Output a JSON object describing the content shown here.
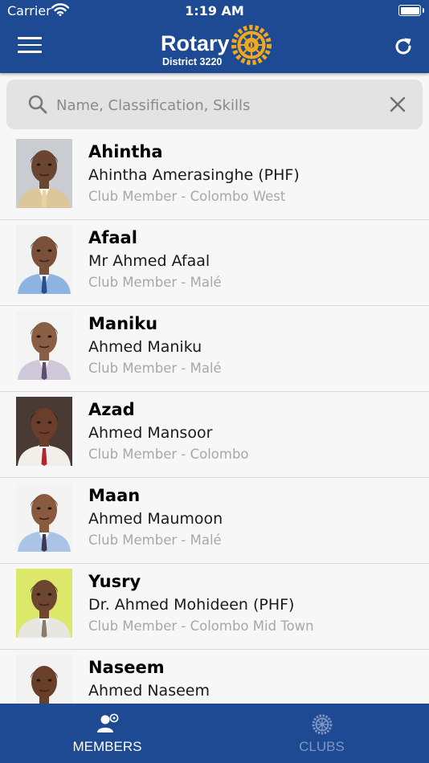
{
  "status_bar": {
    "carrier": "Carrier",
    "time": "1:19 AM"
  },
  "header": {
    "logo_word": "Rotary",
    "logo_subtitle": "District 3220",
    "menu_icon": "hamburger-menu-icon",
    "refresh_icon": "refresh-icon"
  },
  "search": {
    "placeholder": "Name, Classification, Skills",
    "value": "",
    "clear_icon": "close-icon"
  },
  "members": [
    {
      "nickname": "Ahintha",
      "full_name": "Ahintha Amerasinghe (PHF)",
      "club": "Club Member - Colombo West"
    },
    {
      "nickname": "Afaal",
      "full_name": "Mr Ahmed Afaal",
      "club": "Club Member - Malé"
    },
    {
      "nickname": "Maniku",
      "full_name": "Ahmed Maniku",
      "club": "Club Member - Malé"
    },
    {
      "nickname": "Azad",
      "full_name": "Ahmed Mansoor",
      "club": "Club Member - Colombo"
    },
    {
      "nickname": "Maan",
      "full_name": "Ahmed Maumoon",
      "club": "Club Member - Malé"
    },
    {
      "nickname": "Yusry",
      "full_name": "Dr. Ahmed Mohideen (PHF)",
      "club": "Club Member - Colombo Mid Town"
    },
    {
      "nickname": "Naseem",
      "full_name": "Ahmed Naseem",
      "club": ""
    }
  ],
  "tabs": [
    {
      "label": "MEMBERS",
      "icon": "members-icon",
      "active": true
    },
    {
      "label": "CLUBS",
      "icon": "rotary-wheel-icon",
      "active": false
    }
  ],
  "colors": {
    "brand_blue": "#1d4a93",
    "rotary_gold": "#f2a81d",
    "inactive_tab": "#7f97c4",
    "secondary_text": "#a8a8a8"
  }
}
